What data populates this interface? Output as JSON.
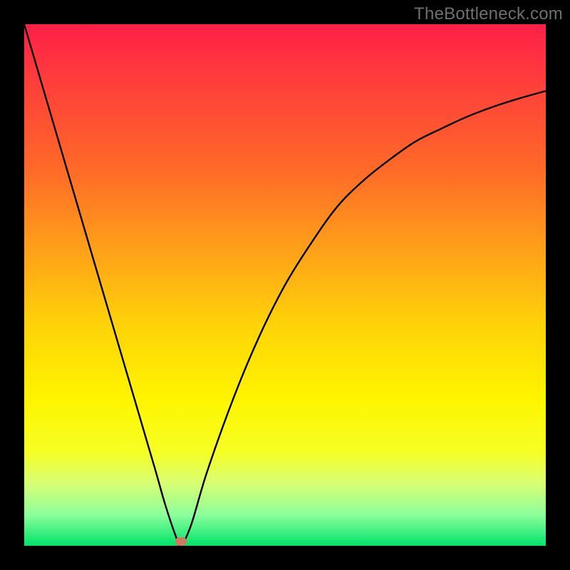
{
  "watermark": "TheBottleneck.com",
  "chart_data": {
    "type": "line",
    "title": "",
    "xlabel": "",
    "ylabel": "",
    "xlim": [
      0,
      100
    ],
    "ylim": [
      0,
      100
    ],
    "series": [
      {
        "name": "curve",
        "x": [
          0,
          5,
          10,
          15,
          20,
          25,
          27,
          29,
          30,
          32,
          35,
          40,
          45,
          50,
          55,
          60,
          65,
          70,
          75,
          80,
          85,
          90,
          95,
          100
        ],
        "values": [
          100,
          83,
          66,
          49,
          32,
          15,
          8,
          2,
          0,
          4,
          14,
          28,
          40,
          50,
          58,
          65,
          70,
          74,
          77.5,
          80,
          82.3,
          84.2,
          85.8,
          87.2
        ]
      }
    ],
    "marker": {
      "x": 30,
      "y": 0.8
    },
    "gradient_stops": [
      {
        "pos": 0,
        "color": "#ff1f48"
      },
      {
        "pos": 10,
        "color": "#ff3b3c"
      },
      {
        "pos": 28,
        "color": "#ff6a28"
      },
      {
        "pos": 44,
        "color": "#ffa318"
      },
      {
        "pos": 58,
        "color": "#ffd408"
      },
      {
        "pos": 72,
        "color": "#fff500"
      },
      {
        "pos": 82,
        "color": "#f6ff24"
      },
      {
        "pos": 88,
        "color": "#d8ff73"
      },
      {
        "pos": 94,
        "color": "#8dff9b"
      },
      {
        "pos": 100,
        "color": "#00e36b"
      }
    ]
  }
}
